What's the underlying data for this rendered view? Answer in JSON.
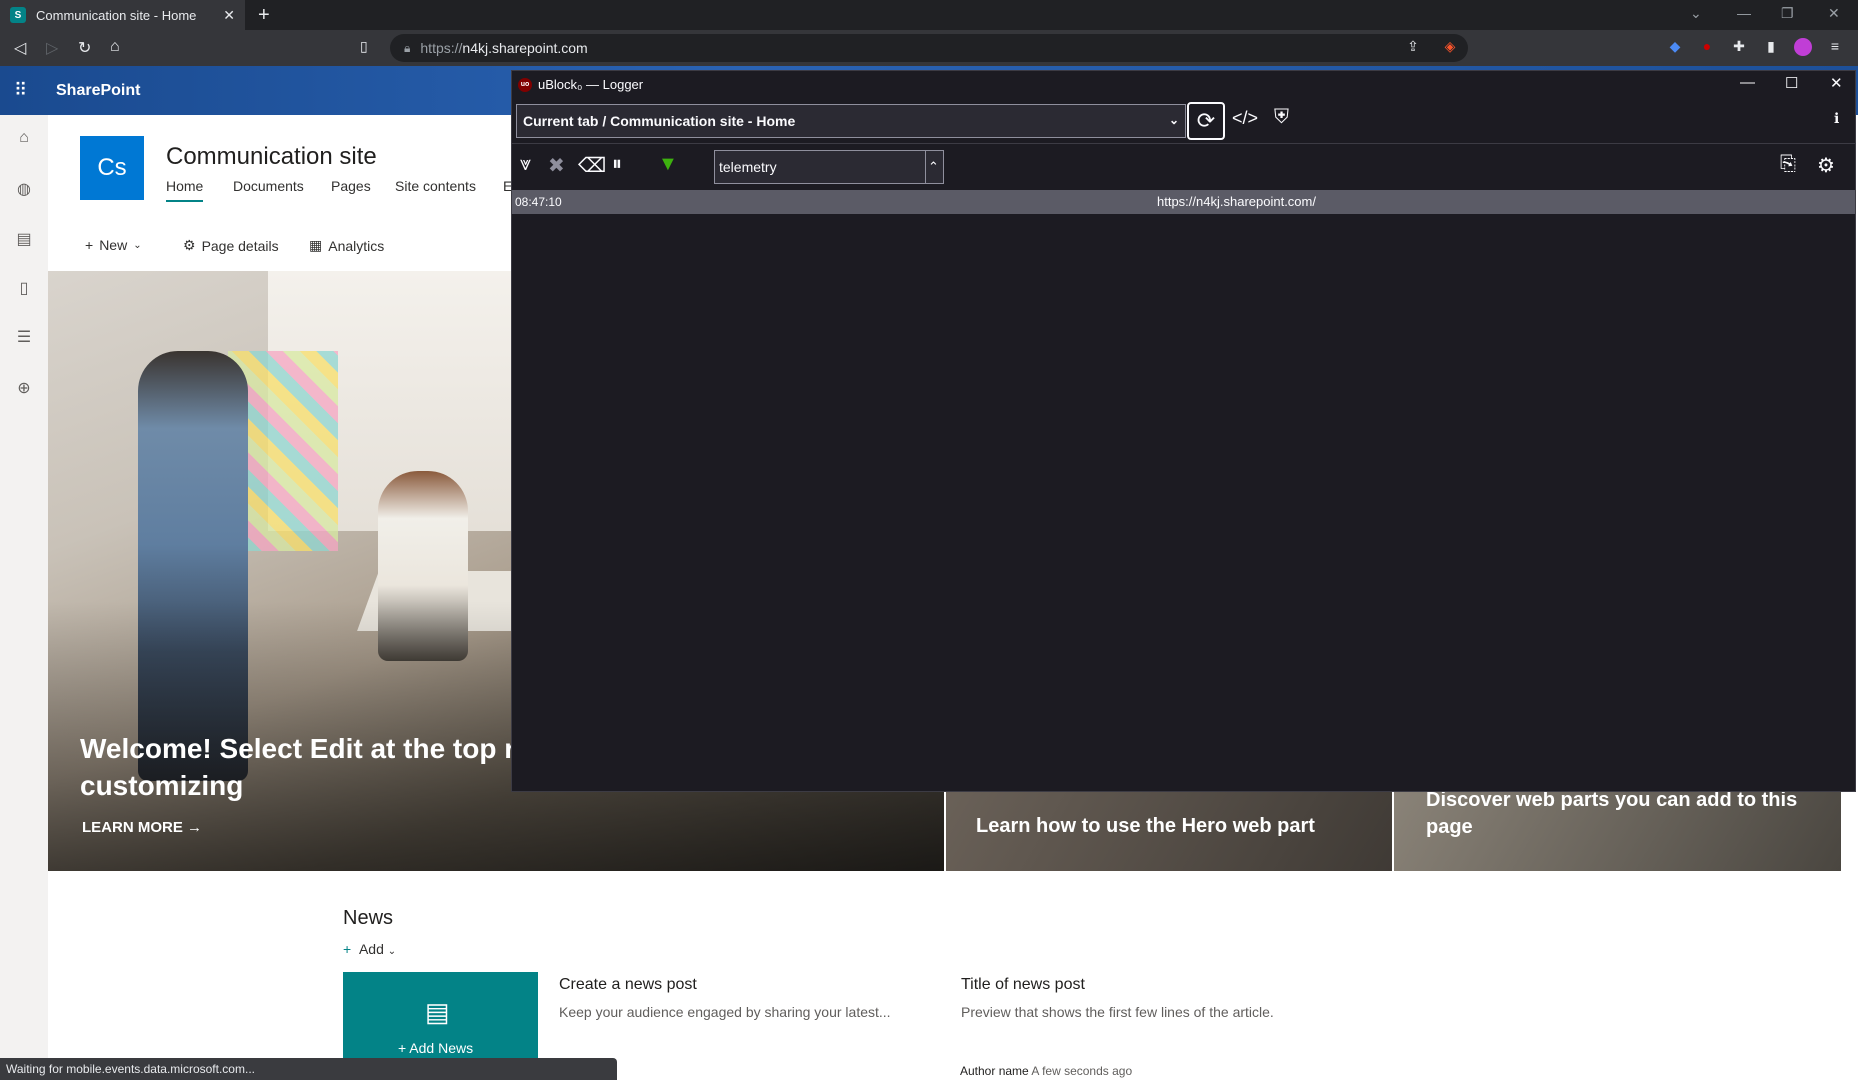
{
  "browser": {
    "tab_title": "Communication site - Home",
    "tab_favicon": "S",
    "url_scheme": "https://",
    "url_host": "n4kj.sharepoint.com"
  },
  "sharepoint": {
    "brand": "SharePoint",
    "site_logo": "Cs",
    "site_title": "Communication site",
    "nav": [
      "Home",
      "Documents",
      "Pages",
      "Site contents",
      "E"
    ],
    "commands": {
      "new": "New",
      "page_details": "Page details",
      "analytics": "Analytics"
    },
    "hero": {
      "title": "Welcome! Select Edit at the top right to start customizing",
      "title_visible": "Welcome! Select Edit at the top rig",
      "title_line2": "customizing",
      "cta": "LEARN MORE →",
      "tile2": "Learn how to use the Hero web part",
      "tile3": "Discover web parts you can add to this page"
    },
    "news": {
      "title": "News",
      "add": "Add",
      "card_label": "Add News",
      "post1_title": "Create a news post",
      "post1_desc": "Keep your audience engaged by sharing your latest...",
      "post2_title": "Title of news post",
      "post2_desc": "Preview that shows the first few lines of the article.",
      "author": "Author name",
      "ago": "A few seconds ago"
    },
    "status": "Waiting for mobile.events.data.microsoft.com..."
  },
  "logger": {
    "window_title": "uBlock₀ — Logger",
    "tab_select": "Current tab / Communication site - Home",
    "filter": "telemetry",
    "entry": {
      "time": "08:47:10",
      "url": "https://n4kj.sharepoint.com/"
    }
  },
  "colors": {
    "accent": "#038387",
    "brand_blue": "#0078d4",
    "logger_bg": "#1c1b22"
  }
}
